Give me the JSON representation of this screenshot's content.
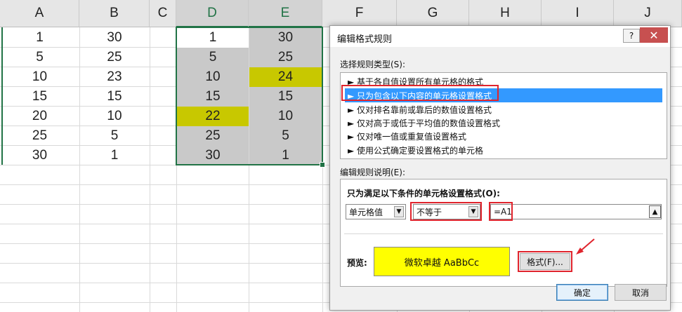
{
  "spreadsheet": {
    "columns": [
      "A",
      "B",
      "C",
      "D",
      "E",
      "F",
      "G",
      "H",
      "I",
      "J"
    ],
    "col_a": [
      "1",
      "5",
      "10",
      "15",
      "20",
      "25",
      "30"
    ],
    "col_b": [
      "30",
      "25",
      "23",
      "15",
      "10",
      "5",
      "1"
    ],
    "col_d": [
      "1",
      "5",
      "10",
      "15",
      "22",
      "25",
      "30"
    ],
    "col_e": [
      "30",
      "25",
      "24",
      "15",
      "10",
      "5",
      "1"
    ],
    "colors": {
      "gray_fill": "#c9c9c9",
      "highlight_fill": "#c8c800",
      "selection": "#217346"
    }
  },
  "dialog": {
    "title": "编辑格式规则",
    "help_label": "?",
    "close_label": "✕",
    "rule_type_label": "选择规则类型(S):",
    "rule_types": [
      "► 基于各自值设置所有单元格的格式",
      "► 只为包含以下内容的单元格设置格式",
      "► 仅对排名靠前或靠后的数值设置格式",
      "► 仅对高于或低于平均值的数值设置格式",
      "► 仅对唯一值或重复值设置格式",
      "► 使用公式确定要设置格式的单元格"
    ],
    "desc_label": "编辑规则说明(E):",
    "desc_heading": "只为满足以下条件的单元格设置格式(O):",
    "cell_value_option": "单元格值",
    "operator_option": "不等于",
    "formula_value": "=A1",
    "preview_label": "预览:",
    "preview_text": "微软卓越  AaBbCc",
    "format_button": "格式(F)...",
    "ok_button": "确定",
    "cancel_button": "取消",
    "colors": {
      "preview_fill": "#ffff00",
      "selected_rule": "#3399ff",
      "annotation_red": "#e0242d"
    }
  }
}
